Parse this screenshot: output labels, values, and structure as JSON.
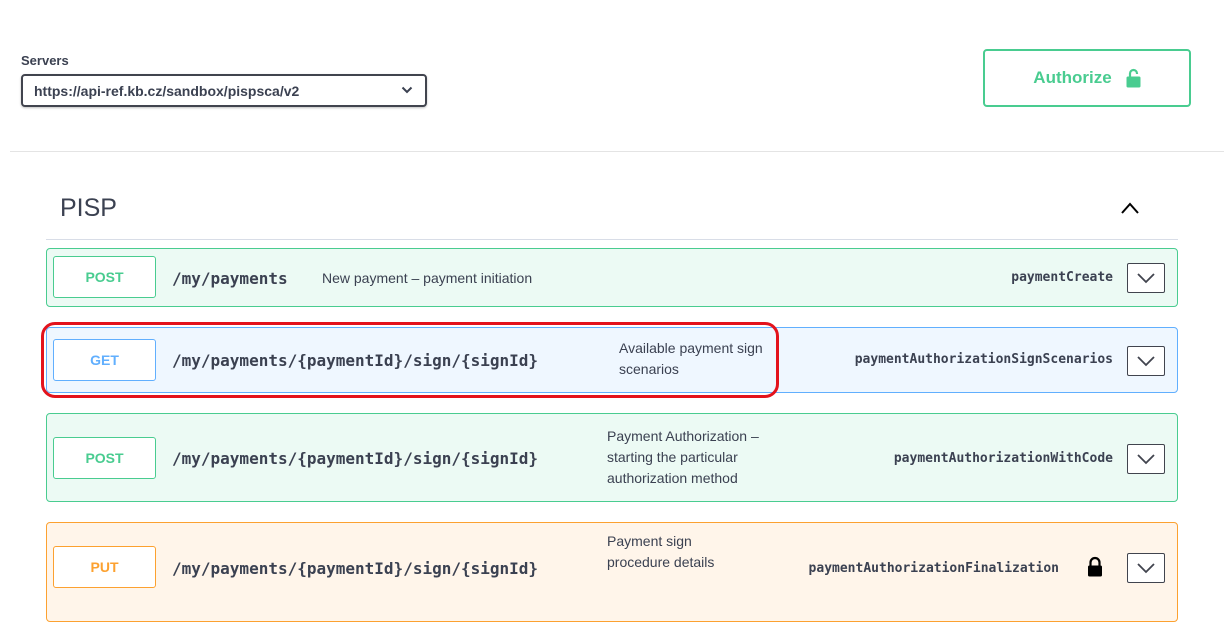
{
  "servers": {
    "label": "Servers",
    "selected": "https://api-ref.kb.cz/sandbox/pispsca/v2"
  },
  "authorize": {
    "label": "Authorize",
    "color": "#49cc90"
  },
  "tag": {
    "title": "PISP"
  },
  "operations": [
    {
      "method": "POST",
      "path": "/my/payments",
      "summary": "New payment – payment initiation",
      "operation_id": "paymentCreate",
      "color": "#49cc90"
    },
    {
      "method": "GET",
      "path": "/my/payments/{paymentId}/sign/{signId}",
      "summary": "Available payment sign scenarios",
      "operation_id": "paymentAuthorizationSignScenarios",
      "color": "#61affe"
    },
    {
      "method": "POST",
      "path": "/my/payments/{paymentId}/sign/{signId}",
      "summary": "Payment Authorization – starting the particular authorization method",
      "operation_id": "paymentAuthorizationWithCode",
      "color": "#49cc90"
    },
    {
      "method": "PUT",
      "path": "/my/payments/{paymentId}/sign/{signId}",
      "summary": "Payment sign procedure details",
      "operation_id": "paymentAuthorizationFinalization",
      "color": "#fca130",
      "locked": true
    }
  ],
  "highlight_color": "#e3131c"
}
